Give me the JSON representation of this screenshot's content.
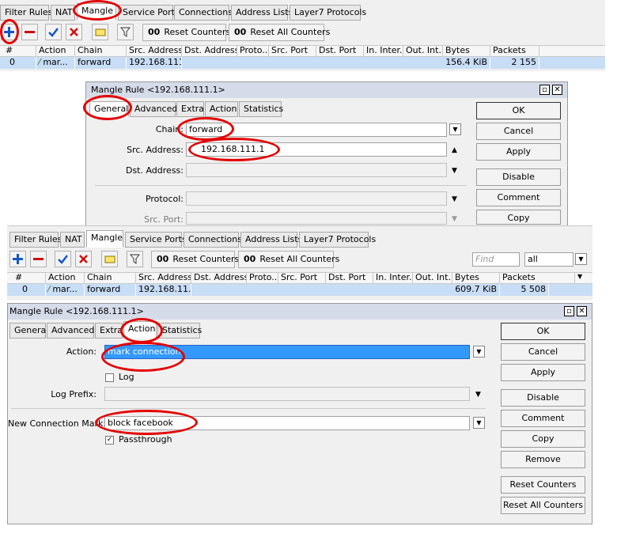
{
  "top": {
    "tabs": [
      "Filter Rules",
      "NAT",
      "Mangle",
      "Service Ports",
      "Connections",
      "Address Lists",
      "Layer7 Protocols"
    ],
    "toolbar": {
      "reset_counters": "Reset Counters",
      "reset_all_counters": "Reset All Counters",
      "counter_icon_text": "00"
    },
    "columns": [
      "#",
      "Action",
      "Chain",
      "Src. Address",
      "Dst. Address",
      "Proto...",
      "Src. Port",
      "Dst. Port",
      "In. Inter...",
      "Out. Int...",
      "Bytes",
      "Packets"
    ],
    "row": {
      "num": "0",
      "action": "mar...",
      "chain": "forward",
      "src": "192.168.111...",
      "bytes": "156.4 KiB",
      "packets": "2 155"
    }
  },
  "dialog1": {
    "title": "Mangle Rule <192.168.111.1>",
    "tabs": [
      "General",
      "Advanced",
      "Extra",
      "Action",
      "Statistics"
    ],
    "fields": {
      "chain_label": "Chain:",
      "chain_value": "forward",
      "src_label": "Src. Address:",
      "src_value": "192.168.111.1",
      "dst_label": "Dst. Address:",
      "protocol_label": "Protocol:",
      "src_port_label": "Src. Port:"
    },
    "buttons": [
      "OK",
      "Cancel",
      "Apply",
      "Disable",
      "Comment",
      "Copy"
    ]
  },
  "bottom": {
    "tabs": [
      "Filter Rules",
      "NAT",
      "Mangle",
      "Service Ports",
      "Connections",
      "Address Lists",
      "Layer7 Protocols"
    ],
    "toolbar": {
      "reset_counters": "Reset Counters",
      "reset_all_counters": "Reset All Counters",
      "counter_icon_text": "00",
      "find_placeholder": "Find",
      "filter_value": "all"
    },
    "columns": [
      "#",
      "Action",
      "Chain",
      "Src. Address",
      "Dst. Address",
      "Proto...",
      "Src. Port",
      "Dst. Port",
      "In. Inter...",
      "Out. Int...",
      "Bytes",
      "Packets"
    ],
    "row": {
      "num": "0",
      "action": "mar...",
      "chain": "forward",
      "src": "192.168.11...",
      "bytes": "609.7 KiB",
      "packets": "5 508"
    }
  },
  "dialog2": {
    "title": "Mangle Rule <192.168.111.1>",
    "tabs": [
      "General",
      "Advanced",
      "Extra",
      "Action",
      "Statistics"
    ],
    "fields": {
      "action_label": "Action:",
      "action_value": "mark connection",
      "log_label": "Log",
      "log_prefix_label": "Log Prefix:",
      "new_conn_mark_label": "New Connection Mark:",
      "new_conn_mark_value": "block facebook",
      "passthrough_label": "Passthrough"
    },
    "buttons": [
      "OK",
      "Cancel",
      "Apply",
      "Disable",
      "Comment",
      "Copy",
      "Remove",
      "Reset Counters",
      "Reset All Counters"
    ]
  }
}
